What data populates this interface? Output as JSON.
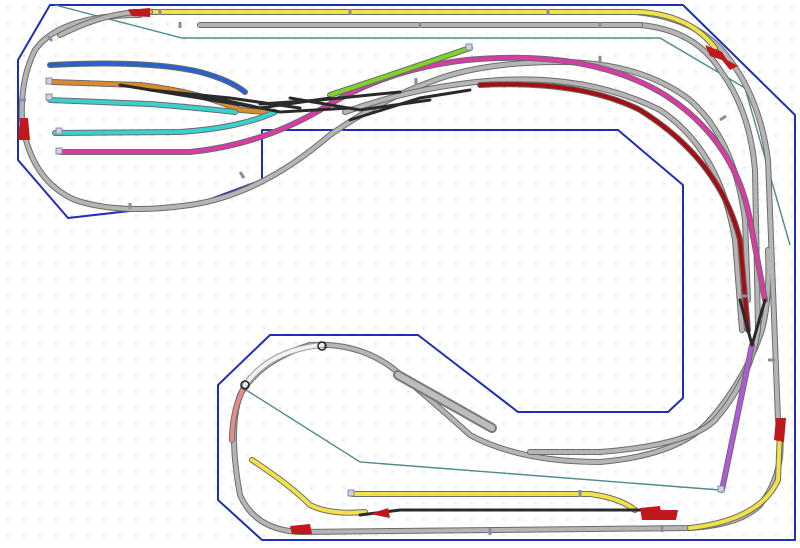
{
  "diagram": {
    "kind": "model-railway-track-plan",
    "grid": true,
    "colors": {
      "background": "#ffffff",
      "grid": "#b9b9c9",
      "baseboard_outline": "#1f2fb5",
      "cable": "#4d8b8b",
      "grey_track": "#b5b5b5",
      "yellow_track": "#f2e24a",
      "magenta_track": "#d83aa6",
      "darkred_track": "#a30f14",
      "blue_track": "#2a62c9",
      "orange_track": "#d98a2c",
      "cyan_track": "#3ccfd0",
      "green_track": "#7fd12b",
      "purple_track": "#b05ad8",
      "pink_track": "#e88b8b",
      "turnout_marker": "#c0181c"
    },
    "tracks": [
      {
        "name": "outer-loop-grey",
        "color": "grey_track"
      },
      {
        "name": "inner-loop-grey",
        "color": "grey_track"
      },
      {
        "name": "top-yellow",
        "color": "yellow_track"
      },
      {
        "name": "bottom-yellow",
        "color": "yellow_track"
      },
      {
        "name": "magenta-siding",
        "color": "magenta_track"
      },
      {
        "name": "darkred-curve",
        "color": "darkred_track"
      },
      {
        "name": "blue-siding",
        "color": "blue_track"
      },
      {
        "name": "orange-siding",
        "color": "orange_track"
      },
      {
        "name": "cyan-siding",
        "color": "cyan_track"
      },
      {
        "name": "green-siding",
        "color": "green_track"
      },
      {
        "name": "purple-link",
        "color": "purple_track"
      },
      {
        "name": "pink-ramp",
        "color": "pink_track"
      }
    ]
  }
}
